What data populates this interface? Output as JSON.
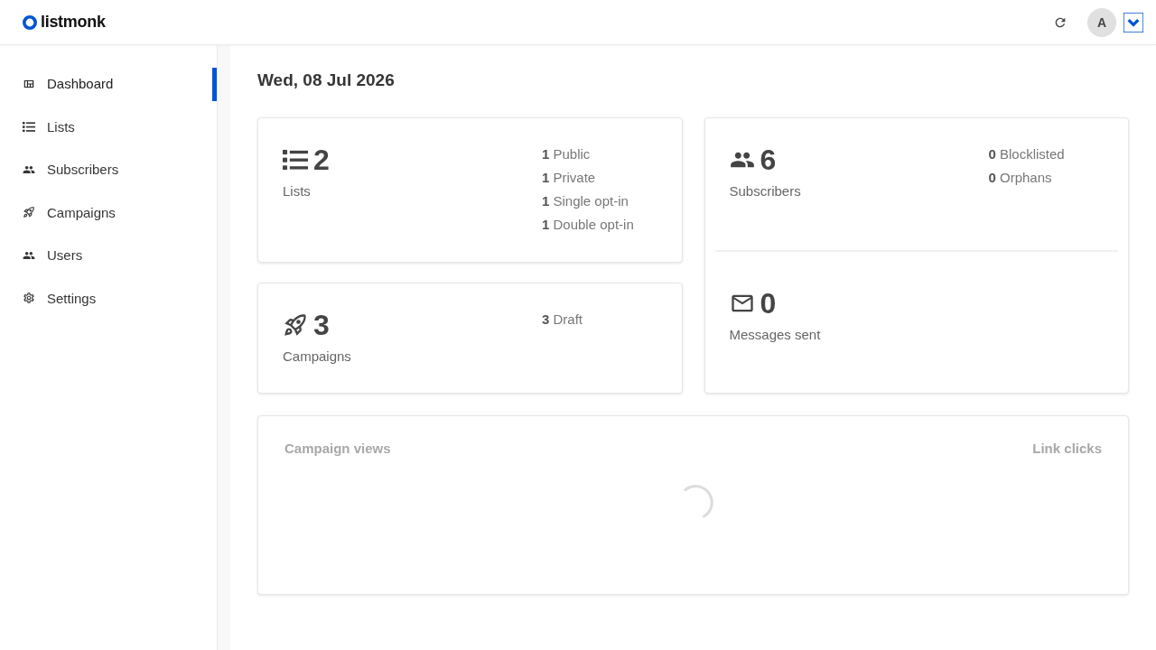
{
  "header": {
    "logo": "listmonk",
    "avatar": "A"
  },
  "sidebar": {
    "items": [
      {
        "kind": "dashboard",
        "label": "Dashboard",
        "selected": true
      },
      {
        "kind": "lists",
        "label": "Lists",
        "selected": false
      },
      {
        "kind": "subscribers",
        "label": "Subscribers",
        "selected": false
      },
      {
        "kind": "campaigns",
        "label": "Campaigns",
        "selected": false
      },
      {
        "kind": "users",
        "label": "Users",
        "selected": false
      },
      {
        "kind": "settings",
        "label": "Settings",
        "selected": false
      }
    ]
  },
  "date": "Wed, 08 Jul 2026",
  "cards": [
    {
      "kind": "lists",
      "count": "2",
      "label": "Lists",
      "stats": [
        "**1** Public",
        "**1** Private",
        "**1** Single opt-in",
        "**1** Double opt-in"
      ]
    },
    {
      "kind": "campaigns",
      "count": "3",
      "label": "Campaigns",
      "stats": [
        "**3** Draft"
      ]
    }
  ],
  "summary_card": {
    "sections": [
      {
        "kind": "subscribers",
        "count": "6",
        "label": "Subscribers",
        "stats": [
          "**0** Blocklisted",
          "**0** Orphans"
        ]
      },
      {
        "kind": "messages",
        "count": "0",
        "label": "Messages sent"
      }
    ]
  },
  "charts_card": {
    "titles": [
      "Campaign views",
      "Link clicks"
    ],
    "loading": true
  }
}
